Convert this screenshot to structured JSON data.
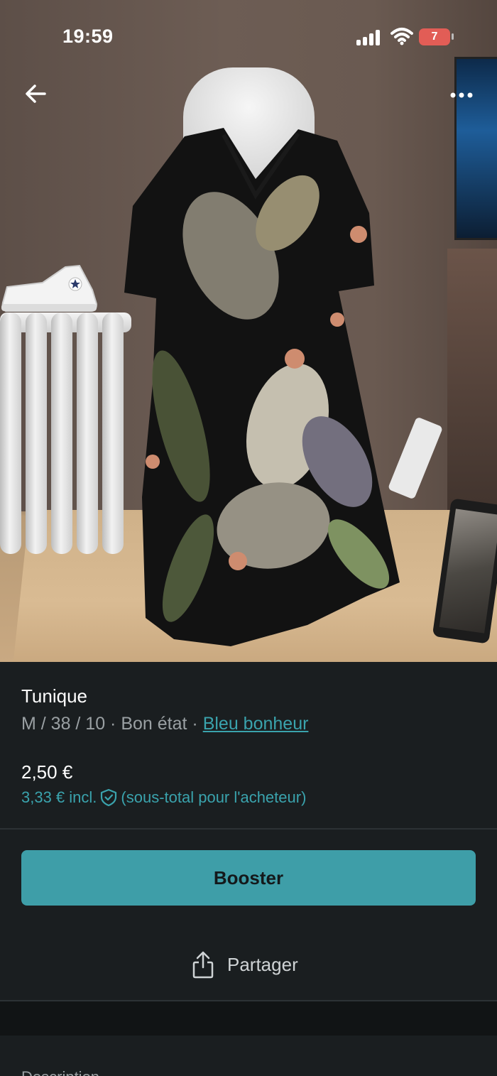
{
  "status_bar": {
    "time": "19:59",
    "battery_level": "7",
    "icons": [
      "cellular-signal-icon",
      "wifi-icon",
      "battery-icon"
    ]
  },
  "navigation": {
    "back_icon": "arrow-left-icon",
    "more_icon": "more-horizontal-icon"
  },
  "listing": {
    "title": "Tunique",
    "size_and_condition": "M / 38 / 10 · Bon état · ",
    "brand": "Bleu bonheur",
    "price": "2,50 €",
    "price_with_protection": "3,33 € incl.",
    "protection_icon": "shield-check-icon",
    "protection_note": "(sous-total pour l'acheteur)"
  },
  "actions": {
    "booster_label": "Booster",
    "share_label": "Partager",
    "share_icon": "share-icon"
  },
  "description": {
    "label": "Description"
  },
  "colors": {
    "background": "#1a1e20",
    "accent": "#3e9ea8",
    "link": "#3aa3ad",
    "muted_text": "#9aa0a3"
  }
}
